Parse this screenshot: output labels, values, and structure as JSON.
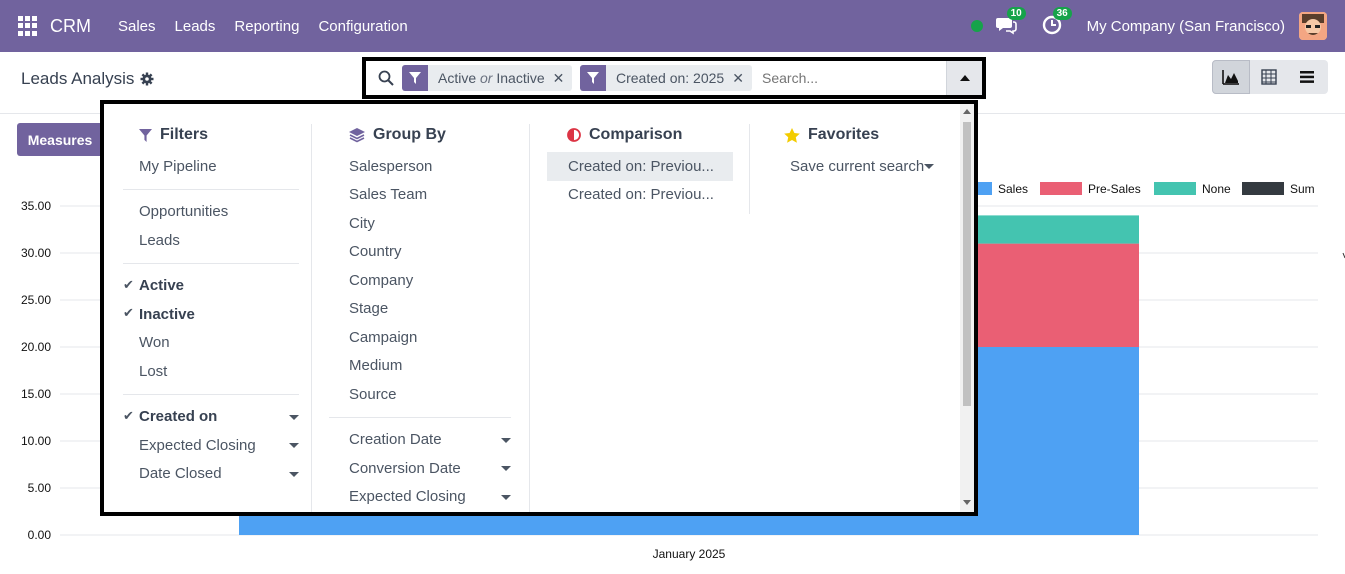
{
  "topbar": {
    "app_name": "CRM",
    "menu": [
      "Sales",
      "Leads",
      "Reporting",
      "Configuration"
    ],
    "messages_count": "10",
    "activities_count": "36",
    "company": "My Company (San Francisco)"
  },
  "page": {
    "title": "Leads Analysis"
  },
  "search": {
    "facets": [
      {
        "parts": [
          "Active",
          "or",
          "Inactive"
        ]
      },
      {
        "parts": [
          "Created on: 2025"
        ]
      }
    ],
    "placeholder": "Search..."
  },
  "toolbar": {
    "measures_label": "Measures"
  },
  "dropdown": {
    "filters": {
      "title": "Filters",
      "groups": [
        [
          {
            "label": "My Pipeline",
            "checked": false
          }
        ],
        [
          {
            "label": "Opportunities",
            "checked": false
          },
          {
            "label": "Leads",
            "checked": false
          }
        ],
        [
          {
            "label": "Active",
            "checked": true
          },
          {
            "label": "Inactive",
            "checked": true
          },
          {
            "label": "Won",
            "checked": false
          },
          {
            "label": "Lost",
            "checked": false
          }
        ],
        [
          {
            "label": "Created on",
            "checked": true,
            "caret": true
          },
          {
            "label": "Expected Closing",
            "checked": false,
            "caret": true
          },
          {
            "label": "Date Closed",
            "checked": false,
            "caret": true
          }
        ]
      ]
    },
    "groupby": {
      "title": "Group By",
      "groups": [
        [
          {
            "label": "Salesperson"
          },
          {
            "label": "Sales Team"
          },
          {
            "label": "City"
          },
          {
            "label": "Country"
          },
          {
            "label": "Company"
          },
          {
            "label": "Stage"
          },
          {
            "label": "Campaign"
          },
          {
            "label": "Medium"
          },
          {
            "label": "Source"
          }
        ],
        [
          {
            "label": "Creation Date",
            "caret": true
          },
          {
            "label": "Conversion Date",
            "caret": true
          },
          {
            "label": "Expected Closing",
            "caret": true
          }
        ]
      ]
    },
    "comparison": {
      "title": "Comparison",
      "items": [
        "Created on: Previou...",
        "Created on: Previou..."
      ]
    },
    "favorites": {
      "title": "Favorites",
      "items": [
        "Save current search"
      ]
    }
  },
  "chart_data": {
    "type": "bar",
    "stacked": true,
    "categories": [
      "January 2025"
    ],
    "series": [
      {
        "name": "Sales",
        "color": "#4ea1f3",
        "values": [
          20
        ]
      },
      {
        "name": "Pre-Sales",
        "color": "#ea5f74",
        "values": [
          11
        ]
      },
      {
        "name": "None",
        "color": "#44c4b0",
        "values": [
          3
        ]
      },
      {
        "name": "Sum",
        "color": "#343a40",
        "values": [
          0
        ]
      }
    ],
    "yticks": [
      "0.00",
      "5.00",
      "10.00",
      "15.00",
      "20.00",
      "25.00",
      "30.00",
      "35.00"
    ],
    "ylim": [
      0,
      35
    ],
    "legend_position": "top-right"
  }
}
